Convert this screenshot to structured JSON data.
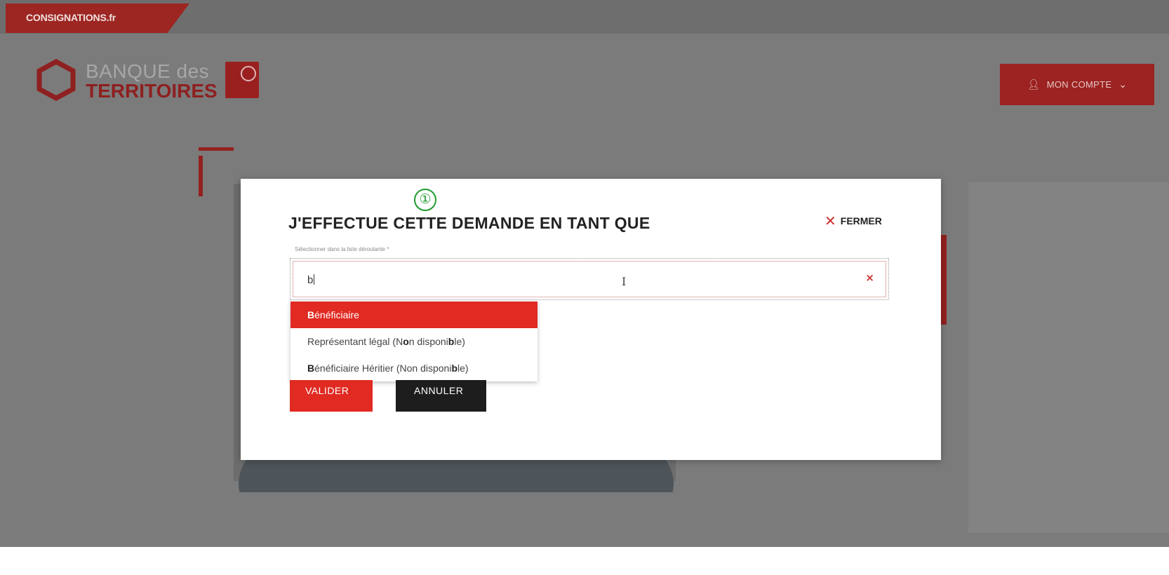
{
  "site_tag": "CONSIGNATIONS.fr",
  "logo": {
    "line1": "BANQUE des",
    "line2": "TERRITOIRES"
  },
  "account": {
    "label": "MON COMPTE",
    "icon": "user-icon",
    "chevron": "chevron-down-icon"
  },
  "modal": {
    "step_marker": "①",
    "title": "J'EFFECTUE CETTE DEMANDE EN TANT QUE",
    "close_label": "FERMER",
    "field_label": "Sélectionner dans la liste déroulante *",
    "input_value": "b",
    "options": [
      {
        "prefix": "B",
        "rest": "énéficiaire",
        "suffix": ""
      },
      {
        "text": "Représentant légal (Non disponible)"
      },
      {
        "prefix": "B",
        "rest": "énéficiaire Héritier (Non disponible)",
        "suffix": ""
      }
    ],
    "validate_label": "VALIDER",
    "cancel_label": "ANNULER"
  },
  "colors": {
    "accent": "#e02a22",
    "brand_dark_red": "#9c2321",
    "overlay": "#7b7b7b",
    "step_green": "#1f9b2d"
  }
}
